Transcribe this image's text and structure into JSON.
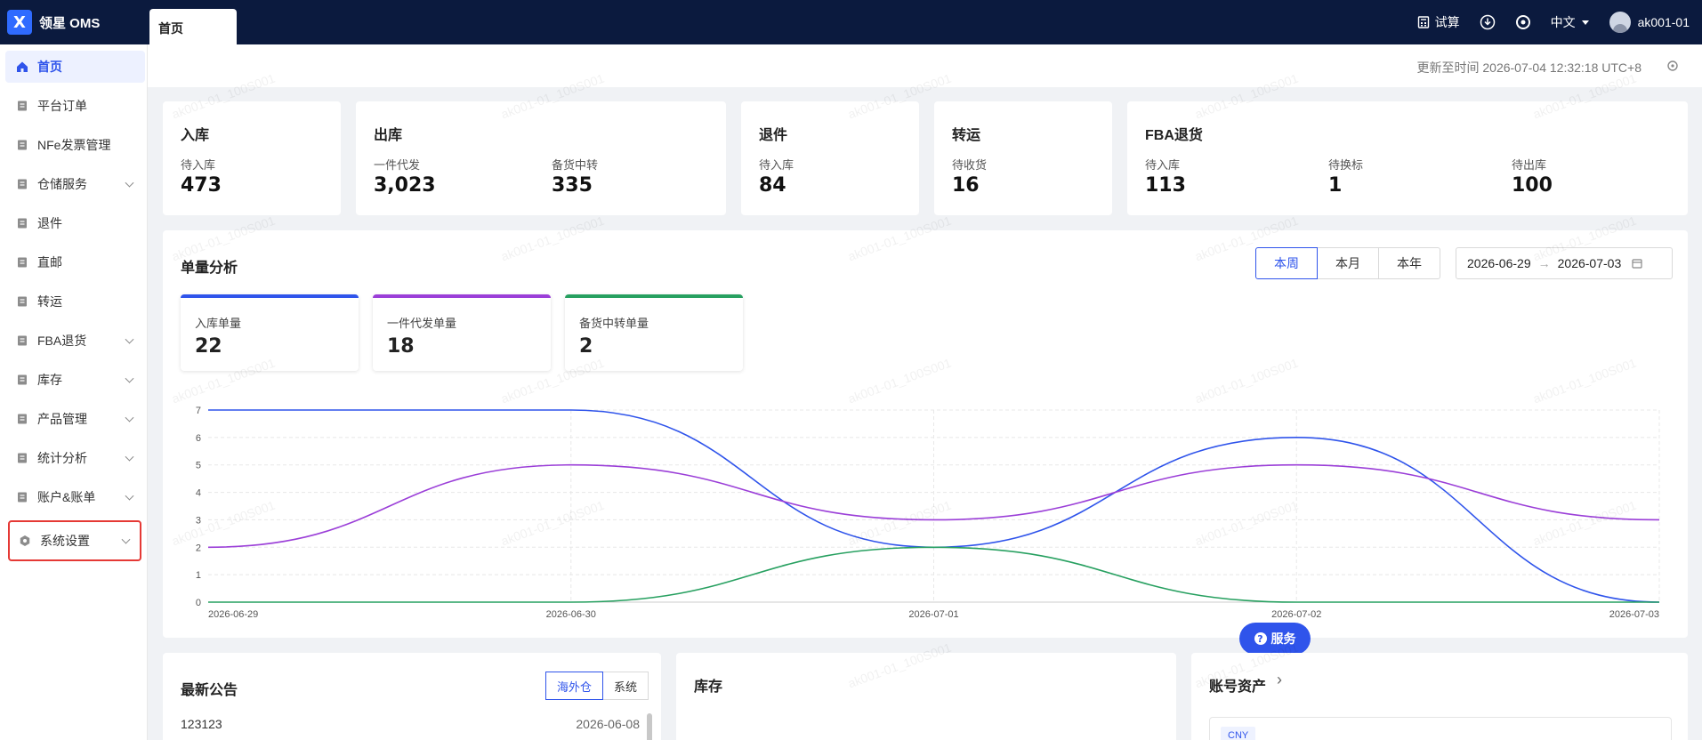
{
  "app": {
    "brand_name": "领星 OMS",
    "logo_glyph": "X",
    "active_tab": "首页"
  },
  "header": {
    "trial_label": "试算",
    "language": "中文",
    "username": "ak001-01"
  },
  "sidebar": {
    "items": [
      {
        "label": "首页",
        "icon": "home-icon",
        "active": true
      },
      {
        "label": "平台订单",
        "icon": "order-icon"
      },
      {
        "label": "NFe发票管理",
        "icon": "invoice-icon"
      },
      {
        "label": "仓储服务",
        "icon": "warehouse-service-icon",
        "expandable": true
      },
      {
        "label": "退件",
        "icon": "return-icon"
      },
      {
        "label": "直邮",
        "icon": "direct-mail-icon"
      },
      {
        "label": "转运",
        "icon": "transfer-icon"
      },
      {
        "label": "FBA退货",
        "icon": "fba-return-icon",
        "expandable": true
      },
      {
        "label": "库存",
        "icon": "inventory-icon",
        "expandable": true
      },
      {
        "label": "产品管理",
        "icon": "product-icon",
        "expandable": true
      },
      {
        "label": "统计分析",
        "icon": "statistics-icon",
        "expandable": true
      },
      {
        "label": "账户&账单",
        "icon": "account-icon",
        "expandable": true
      },
      {
        "label": "系统设置",
        "icon": "settings-icon",
        "expandable": true,
        "highlighted": true
      }
    ]
  },
  "update": {
    "text": "更新至时间 2026-07-04 12:32:18 UTC+8"
  },
  "stats": {
    "inbound": {
      "title": "入库",
      "l1": "待入库",
      "v1": "473"
    },
    "outbound": {
      "title": "出库",
      "l1": "一件代发",
      "v1": "3,023",
      "l2": "备货中转",
      "v2": "335"
    },
    "returns": {
      "title": "退件",
      "l1": "待入库",
      "v1": "84"
    },
    "transfer": {
      "title": "转运",
      "l1": "待收货",
      "v1": "16"
    },
    "fba": {
      "title": "FBA退货",
      "l1": "待入库",
      "v1": "113",
      "l2": "待换标",
      "v2": "1",
      "l3": "待出库",
      "v3": "100"
    }
  },
  "analysis": {
    "title": "单量分析",
    "period_tabs": [
      "本周",
      "本月",
      "本年"
    ],
    "active_period": 0,
    "date_start": "2026-06-29",
    "date_end": "2026-07-03",
    "metrics": [
      {
        "label": "入库单量",
        "value": "22",
        "color": "#2f54eb"
      },
      {
        "label": "一件代发单量",
        "value": "18",
        "color": "#9b3fd8"
      },
      {
        "label": "备货中转单量",
        "value": "2",
        "color": "#27a060"
      }
    ]
  },
  "chart_data": {
    "type": "line",
    "categories": [
      "2026-06-29",
      "2026-06-30",
      "2026-07-01",
      "2026-07-02",
      "2026-07-03"
    ],
    "ylim": [
      0,
      7
    ],
    "yticks": [
      0,
      1,
      2,
      3,
      4,
      5,
      6,
      7
    ],
    "grid": true,
    "smooth": true,
    "series": [
      {
        "values": [
          7,
          7,
          2,
          6,
          0
        ],
        "color": "#2f54eb"
      },
      {
        "values": [
          2,
          5,
          3,
          5,
          3
        ],
        "color": "#9b3fd8"
      },
      {
        "values": [
          0,
          0,
          2,
          0,
          0
        ],
        "color": "#27a060"
      }
    ]
  },
  "service_button": {
    "label": "服务",
    "glyph": "?"
  },
  "announcements": {
    "title": "最新公告",
    "tabs": [
      "海外仓",
      "系统"
    ],
    "first_item": "123123",
    "first_date": "2026-06-08"
  },
  "inventory": {
    "title": "库存"
  },
  "assets": {
    "title": "账号资产",
    "chevron": "›",
    "currency_badge": "CNY"
  },
  "watermark_text": "ak001-01_100S001"
}
